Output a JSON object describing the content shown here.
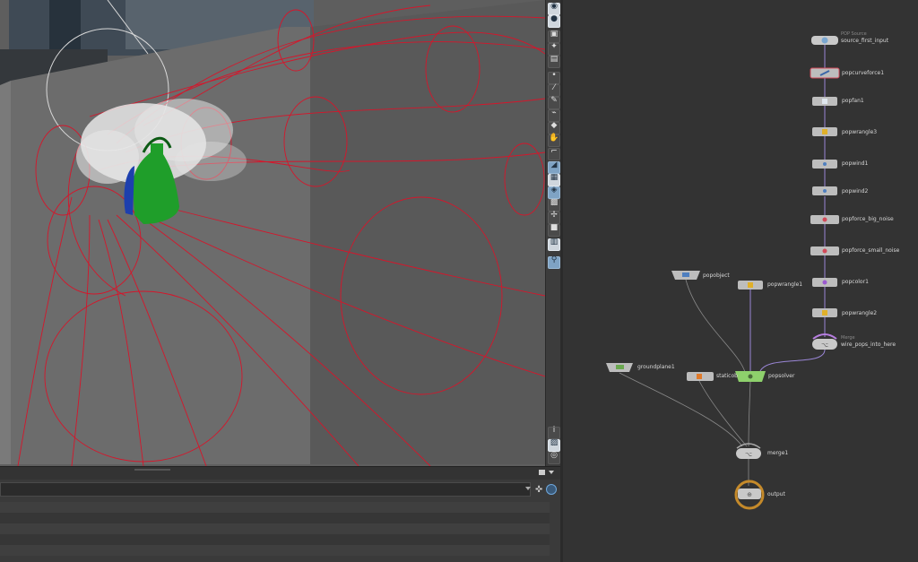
{
  "network": {
    "nodes": [
      {
        "id": "source_first_input",
        "label": "source_first_input",
        "sublabel": "POP Source",
        "type": "source"
      },
      {
        "id": "popcurveforce1",
        "label": "popcurveforce1",
        "type": "curveforce"
      },
      {
        "id": "popfan1",
        "label": "popfan1",
        "type": "fan"
      },
      {
        "id": "popwrangle3",
        "label": "popwrangle3",
        "type": "wrangle"
      },
      {
        "id": "popwind1",
        "label": "popwind1",
        "type": "wind"
      },
      {
        "id": "popwind2",
        "label": "popwind2",
        "type": "wind"
      },
      {
        "id": "popforce_big_noise",
        "label": "popforce_big_noise",
        "type": "force"
      },
      {
        "id": "popforce_small_noise",
        "label": "popforce_small_noise",
        "type": "force"
      },
      {
        "id": "popcolor1",
        "label": "popcolor1",
        "type": "color"
      },
      {
        "id": "popwrangle2",
        "label": "popwrangle2",
        "type": "wrangle"
      },
      {
        "id": "wire_pops_into_here",
        "label": "wire_pops_into_here",
        "sublabel": "Merge",
        "type": "merge"
      },
      {
        "id": "popobject",
        "label": "popobject",
        "type": "object"
      },
      {
        "id": "popwrangle1",
        "label": "popwrangle1",
        "type": "wrangle"
      },
      {
        "id": "groundplane1",
        "label": "groundplane1",
        "type": "ground"
      },
      {
        "id": "staticobject",
        "label": "staticob",
        "type": "static"
      },
      {
        "id": "popsolver",
        "label": "popsolver",
        "type": "solver"
      },
      {
        "id": "merge1",
        "label": "merge1",
        "type": "merge"
      },
      {
        "id": "output",
        "label": "output",
        "type": "output"
      }
    ],
    "colors": {
      "background": "#333333",
      "node_body": "#bdbdbd",
      "solver": "#8ed06c",
      "merge_accent": "#b77ee0",
      "wire_chain": "#9a86d6",
      "wire_gray": "#8a8a8a",
      "output_ring": "#c58a2a"
    }
  },
  "viewport": {
    "colors": {
      "wall": "#6b6b6b",
      "side_wall": "#5b5b5b",
      "guide_curve": "#d5162b",
      "particles": "#e6e6e6",
      "flare": "#1f9e2a"
    }
  },
  "toolbar": {
    "icons": [
      "select-icon",
      "view-icon",
      "camera-icon",
      "light-icon",
      "dot-icon",
      "brush-icon",
      "pen-icon",
      "snap-icon",
      "handle-icon",
      "measure-icon",
      "wireframe-icon",
      "shaded-icon",
      "texture-icon",
      "gallery-icon",
      "pivot-icon",
      "display-icon",
      "background-icon",
      "paint-icon",
      "info-icon",
      "grid-icon",
      "help-icon"
    ]
  }
}
